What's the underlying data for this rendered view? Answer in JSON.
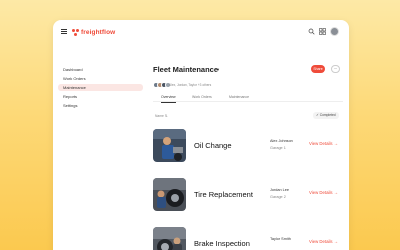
{
  "app": {
    "logo_text": "freightflow",
    "accent": "#ef4b3a"
  },
  "topbar": {
    "icons": [
      "menu-icon",
      "search-icon",
      "grid-icon",
      "avatar"
    ]
  },
  "sidebar": {
    "items": [
      {
        "label": "Dashboard",
        "active": false
      },
      {
        "label": "Work Orders",
        "active": false
      },
      {
        "label": "Maintenance",
        "active": true
      },
      {
        "label": "Reports",
        "active": false
      },
      {
        "label": "Settings",
        "active": false
      }
    ]
  },
  "header": {
    "title": "Fleet Maintenance",
    "share_label": "Share",
    "more_label": "···",
    "collaborators_text": "Alex, Jordan, Taylor +3 others"
  },
  "tabs": [
    {
      "label": "Overview",
      "active": true
    },
    {
      "label": "Work Orders",
      "active": false
    },
    {
      "label": "Maintenance",
      "active": false
    }
  ],
  "filters": {
    "sort_label": "Name",
    "status_badge": "Completed"
  },
  "tasks": [
    {
      "title": "Oil Change",
      "person": "Alex Johnson",
      "garage": "Garage 1",
      "link": "View Details"
    },
    {
      "title": "Tire Replacement",
      "person": "Jordan Lee",
      "garage": "Garage 2",
      "link": "View Details"
    },
    {
      "title": "Brake Inspection",
      "person": "Taylor Smith",
      "garage": "",
      "link": "View Details"
    }
  ]
}
